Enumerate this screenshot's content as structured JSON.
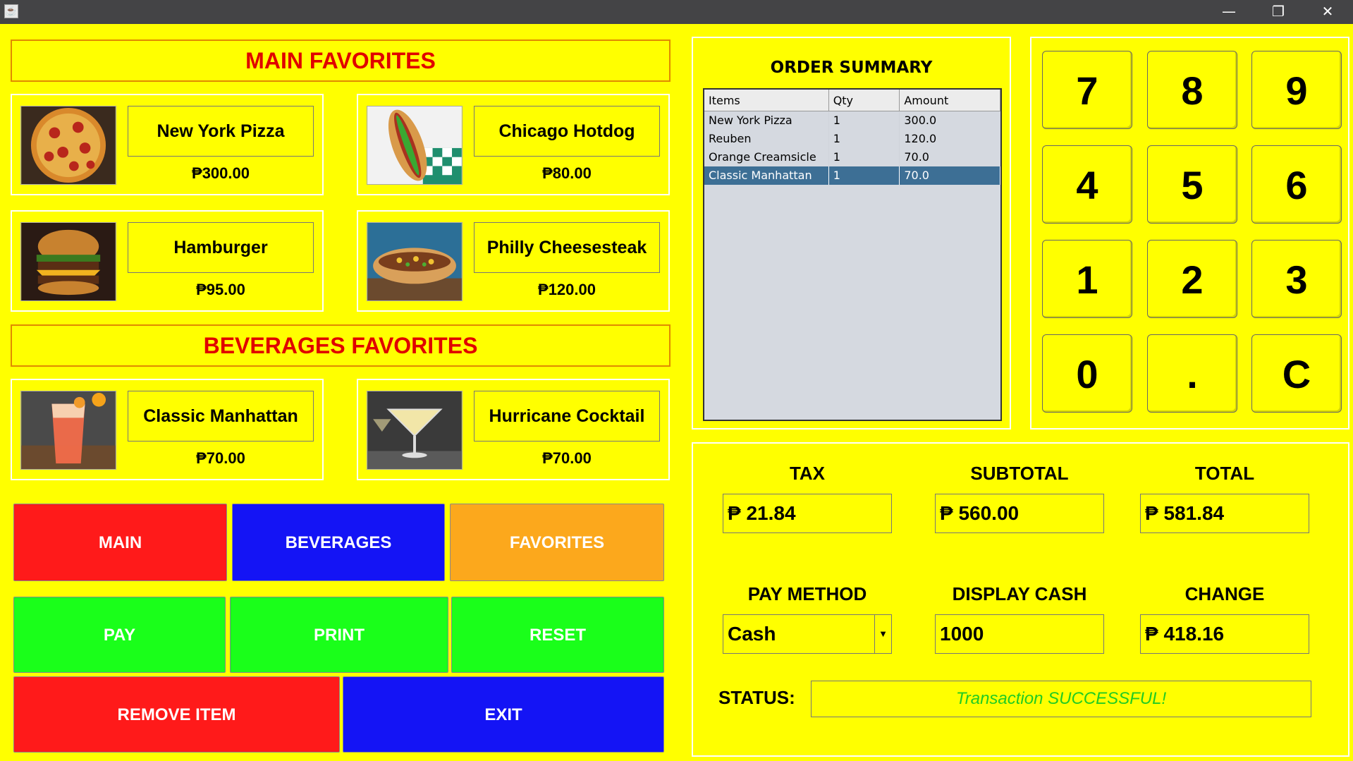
{
  "window": {
    "minimize": "—",
    "restore": "❐",
    "close": "✕"
  },
  "main_favorites": {
    "title": "MAIN FAVORITES",
    "items": [
      {
        "name": "New York Pizza",
        "price": "₱300.00",
        "image": "pizza"
      },
      {
        "name": "Chicago Hotdog",
        "price": "₱80.00",
        "image": "hotdog"
      },
      {
        "name": "Hamburger",
        "price": "₱95.00",
        "image": "hamburger"
      },
      {
        "name": "Philly Cheesesteak",
        "price": "₱120.00",
        "image": "cheesesteak"
      }
    ]
  },
  "beverage_favorites": {
    "title": "BEVERAGES FAVORITES",
    "items": [
      {
        "name": "Classic Manhattan",
        "price": "₱70.00",
        "image": "red-cocktail"
      },
      {
        "name": "Hurricane Cocktail",
        "price": "₱70.00",
        "image": "martini"
      }
    ]
  },
  "category_buttons": {
    "main": "MAIN",
    "beverages": "BEVERAGES",
    "favorites": "FAVORITES"
  },
  "action_buttons": {
    "pay": "PAY",
    "print": "PRINT",
    "reset": "RESET",
    "remove": "REMOVE ITEM",
    "exit": "EXIT"
  },
  "order_summary": {
    "title": "ORDER SUMMARY",
    "columns": [
      "Items",
      "Qty",
      "Amount"
    ],
    "rows": [
      [
        "New York Pizza",
        "1",
        "300.0"
      ],
      [
        "Reuben",
        "1",
        "120.0"
      ],
      [
        "Orange Creamsicle",
        "1",
        "70.0"
      ],
      [
        "Classic Manhattan",
        "1",
        "70.0"
      ]
    ],
    "selected_row": 3
  },
  "keypad": [
    "7",
    "8",
    "9",
    "4",
    "5",
    "6",
    "1",
    "2",
    "3",
    "0",
    ".",
    "C"
  ],
  "totals": {
    "tax_label": "TAX",
    "tax": "₱ 21.84",
    "subtotal_label": "SUBTOTAL",
    "subtotal": "₱ 560.00",
    "total_label": "TOTAL",
    "total": "₱ 581.84",
    "pay_method_label": "PAY METHOD",
    "pay_method": "Cash",
    "cash_label": "DISPLAY CASH",
    "cash": "1000",
    "change_label": "CHANGE",
    "change": "₱ 418.16",
    "status_label": "STATUS:",
    "status": "Transaction SUCCESSFUL!"
  },
  "colors": {
    "background": "#ffff00",
    "red": "#ff1a1a",
    "blue": "#1414f5",
    "orange": "#fca81c",
    "green": "#1aff1a",
    "status_text": "#22cc22"
  }
}
